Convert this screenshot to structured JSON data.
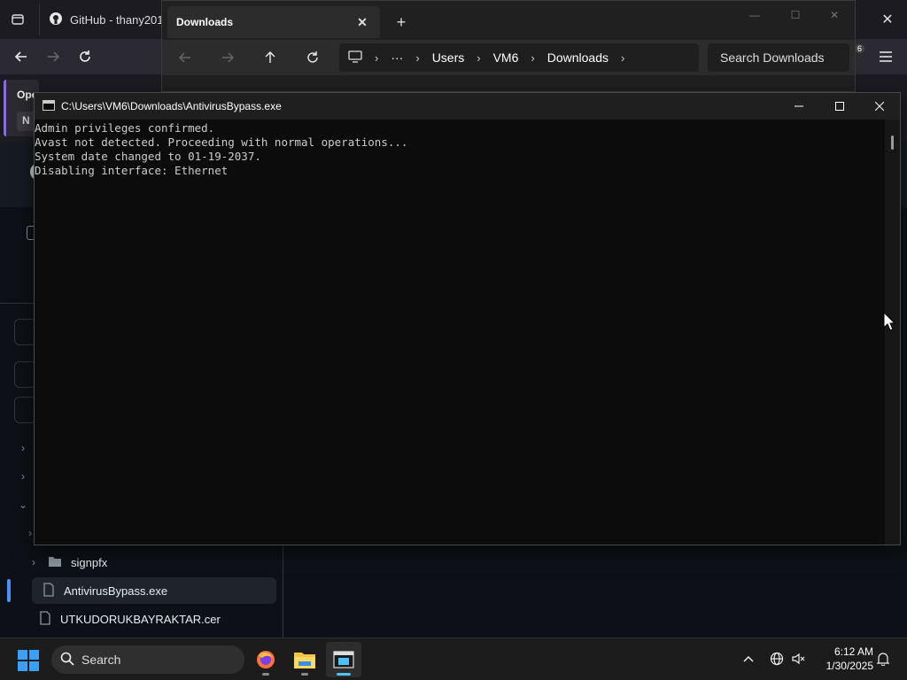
{
  "browser": {
    "tab_title": "GitHub - thany2010/",
    "notice_title": "Ope",
    "notice_button": "N",
    "sidebar": {
      "items": [
        {
          "label": "signpfx",
          "type": "folder"
        },
        {
          "label": "AntivirusBypass.exe",
          "type": "file",
          "selected": true
        },
        {
          "label": "UTKUDORUKBAYRAKTAR.cer",
          "type": "file"
        }
      ]
    },
    "extension_badge": "6"
  },
  "explorer": {
    "tab_title": "Downloads",
    "breadcrumb": [
      "Users",
      "VM6",
      "Downloads"
    ],
    "search_placeholder": "Search Downloads"
  },
  "console": {
    "title": "C:\\Users\\VM6\\Downloads\\AntivirusBypass.exe",
    "lines": [
      "Admin privileges confirmed.",
      "Avast not detected. Proceeding with normal operations...",
      "System date changed to 01-19-2037.",
      "Disabling interface: Ethernet"
    ]
  },
  "taskbar": {
    "search_label": "Search",
    "time": "6:12 AM",
    "date": "1/30/2025",
    "apps": [
      "firefox-icon",
      "file-explorer-icon",
      "terminal-icon"
    ]
  },
  "colors": {
    "console_bg": "#0c0c0c",
    "console_text": "#cccccc",
    "accent": "#4cc2ff",
    "github_bg": "#0d1117"
  }
}
